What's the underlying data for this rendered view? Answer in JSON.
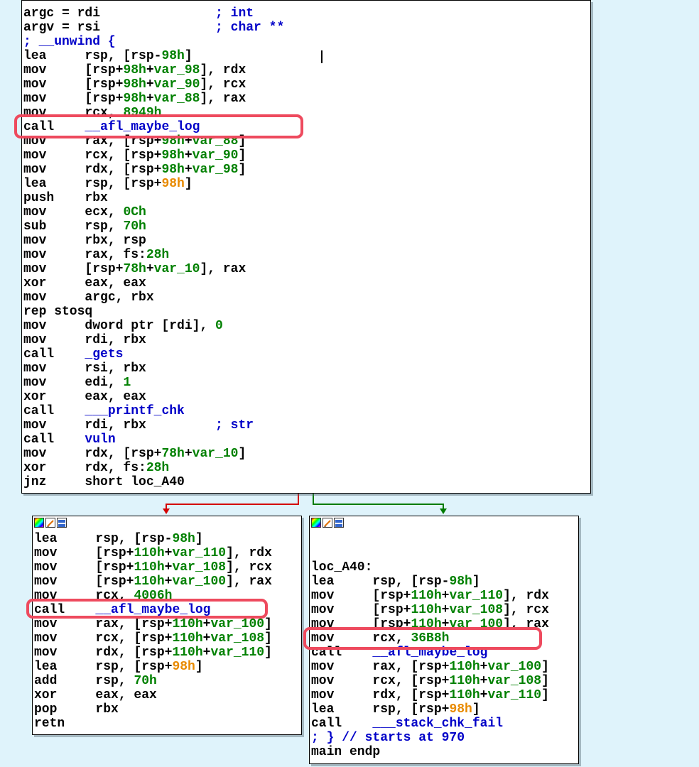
{
  "colors": {
    "background": "#dff3fb",
    "highlight": "#ee4a5e",
    "number": "#008000",
    "name": "#0000c8",
    "offset": "#e88a00",
    "edge_true": "#d40000",
    "edge_false": "#007a00"
  },
  "blocks": [
    {
      "id": "main-block",
      "has_header": false,
      "lines": [
        [
          {
            "t": "argc = rdi               "
          },
          {
            "t": "; int",
            "c": "cm"
          }
        ],
        [
          {
            "t": "argv = rsi               "
          },
          {
            "t": "; char **",
            "c": "cm"
          }
        ],
        [
          {
            "t": "; __unwind {",
            "c": "cm"
          }
        ],
        [
          {
            "t": "lea     rsp, [rsp-"
          },
          {
            "t": "98h",
            "c": "num"
          },
          {
            "t": "]"
          }
        ],
        [
          {
            "t": "mov     [rsp+"
          },
          {
            "t": "98h",
            "c": "num"
          },
          {
            "t": "+"
          },
          {
            "t": "var_98",
            "c": "num"
          },
          {
            "t": "], rdx"
          }
        ],
        [
          {
            "t": "mov     [rsp+"
          },
          {
            "t": "98h",
            "c": "num"
          },
          {
            "t": "+"
          },
          {
            "t": "var_90",
            "c": "num"
          },
          {
            "t": "], rcx"
          }
        ],
        [
          {
            "t": "mov     [rsp+"
          },
          {
            "t": "98h",
            "c": "num"
          },
          {
            "t": "+"
          },
          {
            "t": "var_88",
            "c": "num"
          },
          {
            "t": "], rax"
          }
        ],
        [
          {
            "t": "mov     rcx, "
          },
          {
            "t": "8949h",
            "c": "num"
          }
        ],
        [
          {
            "t": "call    "
          },
          {
            "t": "__afl_maybe_log",
            "c": "fn"
          }
        ],
        [
          {
            "t": "mov     rax, [rsp+"
          },
          {
            "t": "98h",
            "c": "num"
          },
          {
            "t": "+"
          },
          {
            "t": "var_88",
            "c": "num"
          },
          {
            "t": "]"
          }
        ],
        [
          {
            "t": "mov     rcx, [rsp+"
          },
          {
            "t": "98h",
            "c": "num"
          },
          {
            "t": "+"
          },
          {
            "t": "var_90",
            "c": "num"
          },
          {
            "t": "]"
          }
        ],
        [
          {
            "t": "mov     rdx, [rsp+"
          },
          {
            "t": "98h",
            "c": "num"
          },
          {
            "t": "+"
          },
          {
            "t": "var_98",
            "c": "num"
          },
          {
            "t": "]"
          }
        ],
        [
          {
            "t": "lea     rsp, [rsp+"
          },
          {
            "t": "98h",
            "c": "or"
          },
          {
            "t": "]"
          }
        ],
        [
          {
            "t": "push    rbx"
          }
        ],
        [
          {
            "t": "mov     ecx, "
          },
          {
            "t": "0Ch",
            "c": "num"
          }
        ],
        [
          {
            "t": "sub     rsp, "
          },
          {
            "t": "70h",
            "c": "num"
          }
        ],
        [
          {
            "t": "mov     rbx, rsp"
          }
        ],
        [
          {
            "t": "mov     rax, fs:"
          },
          {
            "t": "28h",
            "c": "num"
          }
        ],
        [
          {
            "t": "mov     [rsp+"
          },
          {
            "t": "78h",
            "c": "num"
          },
          {
            "t": "+"
          },
          {
            "t": "var_10",
            "c": "num"
          },
          {
            "t": "], rax"
          }
        ],
        [
          {
            "t": "xor     eax, eax"
          }
        ],
        [
          {
            "t": "mov     argc, rbx"
          }
        ],
        [
          {
            "t": "rep stosq"
          }
        ],
        [
          {
            "t": "mov     dword ptr [rdi], "
          },
          {
            "t": "0",
            "c": "num"
          }
        ],
        [
          {
            "t": "mov     rdi, rbx"
          }
        ],
        [
          {
            "t": "call    "
          },
          {
            "t": "_gets",
            "c": "fn"
          }
        ],
        [
          {
            "t": "mov     rsi, rbx"
          }
        ],
        [
          {
            "t": "mov     edi, "
          },
          {
            "t": "1",
            "c": "num"
          }
        ],
        [
          {
            "t": "xor     eax, eax"
          }
        ],
        [
          {
            "t": "call    "
          },
          {
            "t": "___printf_chk",
            "c": "fn"
          }
        ],
        [
          {
            "t": "mov     rdi, rbx         "
          },
          {
            "t": "; str",
            "c": "cm"
          }
        ],
        [
          {
            "t": "call    "
          },
          {
            "t": "vuln",
            "c": "fn"
          }
        ],
        [
          {
            "t": "mov     rdx, [rsp+"
          },
          {
            "t": "78h",
            "c": "num"
          },
          {
            "t": "+"
          },
          {
            "t": "var_10",
            "c": "num"
          },
          {
            "t": "]"
          }
        ],
        [
          {
            "t": "xor     rdx, fs:"
          },
          {
            "t": "28h",
            "c": "num"
          }
        ],
        [
          {
            "t": "jnz     short loc_A40"
          }
        ]
      ]
    },
    {
      "id": "left-block",
      "has_header": true,
      "lines": [
        [
          {
            "t": "lea     rsp, [rsp-"
          },
          {
            "t": "98h",
            "c": "num"
          },
          {
            "t": "]"
          }
        ],
        [
          {
            "t": "mov     [rsp+"
          },
          {
            "t": "110h",
            "c": "num"
          },
          {
            "t": "+"
          },
          {
            "t": "var_110",
            "c": "num"
          },
          {
            "t": "], rdx"
          }
        ],
        [
          {
            "t": "mov     [rsp+"
          },
          {
            "t": "110h",
            "c": "num"
          },
          {
            "t": "+"
          },
          {
            "t": "var_108",
            "c": "num"
          },
          {
            "t": "], rcx"
          }
        ],
        [
          {
            "t": "mov     [rsp+"
          },
          {
            "t": "110h",
            "c": "num"
          },
          {
            "t": "+"
          },
          {
            "t": "var_100",
            "c": "num"
          },
          {
            "t": "], rax"
          }
        ],
        [
          {
            "t": "mov     rcx, "
          },
          {
            "t": "4006h",
            "c": "num"
          }
        ],
        [
          {
            "t": "call    "
          },
          {
            "t": "__afl_maybe_log",
            "c": "fn"
          }
        ],
        [
          {
            "t": "mov     rax, [rsp+"
          },
          {
            "t": "110h",
            "c": "num"
          },
          {
            "t": "+"
          },
          {
            "t": "var_100",
            "c": "num"
          },
          {
            "t": "]"
          }
        ],
        [
          {
            "t": "mov     rcx, [rsp+"
          },
          {
            "t": "110h",
            "c": "num"
          },
          {
            "t": "+"
          },
          {
            "t": "var_108",
            "c": "num"
          },
          {
            "t": "]"
          }
        ],
        [
          {
            "t": "mov     rdx, [rsp+"
          },
          {
            "t": "110h",
            "c": "num"
          },
          {
            "t": "+"
          },
          {
            "t": "var_110",
            "c": "num"
          },
          {
            "t": "]"
          }
        ],
        [
          {
            "t": "lea     rsp, [rsp+"
          },
          {
            "t": "98h",
            "c": "or"
          },
          {
            "t": "]"
          }
        ],
        [
          {
            "t": "add     rsp, "
          },
          {
            "t": "70h",
            "c": "num"
          }
        ],
        [
          {
            "t": "xor     eax, eax"
          }
        ],
        [
          {
            "t": "pop     rbx"
          }
        ],
        [
          {
            "t": "retn"
          }
        ]
      ]
    },
    {
      "id": "right-block",
      "has_header": true,
      "lines": [
        [
          {
            "t": ""
          }
        ],
        [
          {
            "t": "loc_A40:"
          }
        ],
        [
          {
            "t": "lea     rsp, [rsp-"
          },
          {
            "t": "98h",
            "c": "num"
          },
          {
            "t": "]"
          }
        ],
        [
          {
            "t": "mov     [rsp+"
          },
          {
            "t": "110h",
            "c": "num"
          },
          {
            "t": "+"
          },
          {
            "t": "var_110",
            "c": "num"
          },
          {
            "t": "], rdx"
          }
        ],
        [
          {
            "t": "mov     [rsp+"
          },
          {
            "t": "110h",
            "c": "num"
          },
          {
            "t": "+"
          },
          {
            "t": "var_108",
            "c": "num"
          },
          {
            "t": "], rcx"
          }
        ],
        [
          {
            "t": "mov     [rsp+"
          },
          {
            "t": "110h",
            "c": "num"
          },
          {
            "t": "+"
          },
          {
            "t": "var_100",
            "c": "num"
          },
          {
            "t": "], rax"
          }
        ],
        [
          {
            "t": "mov     rcx, "
          },
          {
            "t": "36B8h",
            "c": "num"
          }
        ],
        [
          {
            "t": "call    "
          },
          {
            "t": "__afl_maybe_log",
            "c": "fn"
          }
        ],
        [
          {
            "t": "mov     rax, [rsp+"
          },
          {
            "t": "110h",
            "c": "num"
          },
          {
            "t": "+"
          },
          {
            "t": "var_100",
            "c": "num"
          },
          {
            "t": "]"
          }
        ],
        [
          {
            "t": "mov     rcx, [rsp+"
          },
          {
            "t": "110h",
            "c": "num"
          },
          {
            "t": "+"
          },
          {
            "t": "var_108",
            "c": "num"
          },
          {
            "t": "]"
          }
        ],
        [
          {
            "t": "mov     rdx, [rsp+"
          },
          {
            "t": "110h",
            "c": "num"
          },
          {
            "t": "+"
          },
          {
            "t": "var_110",
            "c": "num"
          },
          {
            "t": "]"
          }
        ],
        [
          {
            "t": "lea     rsp, [rsp+"
          },
          {
            "t": "98h",
            "c": "or"
          },
          {
            "t": "]"
          }
        ],
        [
          {
            "t": "call    "
          },
          {
            "t": "___stack_chk_fail",
            "c": "fn"
          }
        ],
        [
          {
            "t": "; } // starts at 970",
            "c": "cm"
          }
        ],
        [
          {
            "t": "main endp"
          }
        ]
      ]
    }
  ]
}
